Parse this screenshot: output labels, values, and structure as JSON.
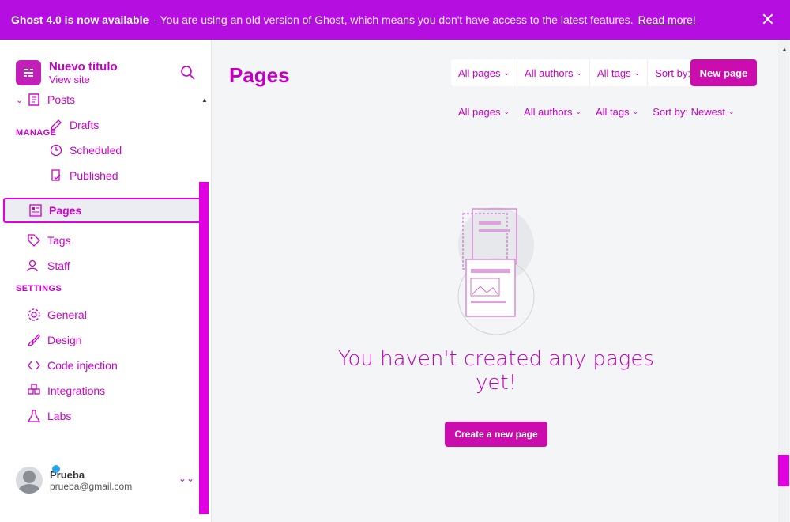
{
  "banner": {
    "title": "Ghost 4.0 is now available",
    "text": "- You are using an old version of Ghost, which means you don't have access to the latest features.",
    "link": "Read more!"
  },
  "brand": {
    "name": "Nuevo titulo",
    "view_site": "View site"
  },
  "nav": {
    "posts": "Posts",
    "drafts": "Drafts",
    "scheduled": "Scheduled",
    "published": "Published",
    "pages": "Pages",
    "tags": "Tags",
    "staff": "Staff",
    "general": "General",
    "design": "Design",
    "code_injection": "Code injection",
    "integrations": "Integrations",
    "labs": "Labs"
  },
  "sections": {
    "manage": "MANAGE",
    "settings": "SETTINGS"
  },
  "user": {
    "name": "Prueba",
    "email": "prueba@gmail.com"
  },
  "main": {
    "title": "Pages",
    "filters": [
      "All pages",
      "All authors",
      "All tags",
      "Sort by: Newest"
    ],
    "new_page": "New page",
    "empty_text": "You haven't created any pages yet!",
    "create_button": "Create a new page"
  },
  "colors": {
    "accent": "#cc0dae",
    "banner": "#b40fe0",
    "text": "#c800c8"
  }
}
